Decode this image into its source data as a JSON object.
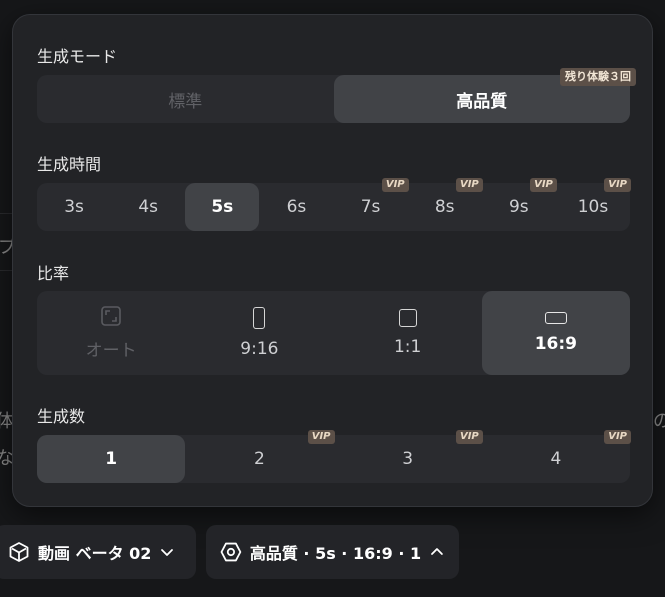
{
  "background": {
    "fragments": [
      "プ",
      "体",
      "な",
      "の"
    ]
  },
  "panel": {
    "mode": {
      "title": "生成モード",
      "options": [
        {
          "label": "標準",
          "selected": false,
          "disabled": true
        },
        {
          "label": "高品質",
          "selected": true,
          "badge": "残り体験３回"
        }
      ]
    },
    "duration": {
      "title": "生成時間",
      "vip_label": "VIP",
      "options": [
        {
          "label": "3s",
          "selected": false,
          "vip": false
        },
        {
          "label": "4s",
          "selected": false,
          "vip": false
        },
        {
          "label": "5s",
          "selected": true,
          "vip": false
        },
        {
          "label": "6s",
          "selected": false,
          "vip": false
        },
        {
          "label": "7s",
          "selected": false,
          "vip": true
        },
        {
          "label": "8s",
          "selected": false,
          "vip": true
        },
        {
          "label": "9s",
          "selected": false,
          "vip": true
        },
        {
          "label": "10s",
          "selected": false,
          "vip": true
        }
      ]
    },
    "ratio": {
      "title": "比率",
      "options": [
        {
          "label": "オート",
          "selected": false,
          "disabled": true,
          "icon": "auto-ratio-icon"
        },
        {
          "label": "9:16",
          "selected": false,
          "icon": "portrait-ratio-icon"
        },
        {
          "label": "1:1",
          "selected": false,
          "icon": "square-ratio-icon"
        },
        {
          "label": "16:9",
          "selected": true,
          "icon": "landscape-ratio-icon"
        }
      ]
    },
    "count": {
      "title": "生成数",
      "vip_label": "VIP",
      "options": [
        {
          "label": "1",
          "selected": true,
          "vip": false
        },
        {
          "label": "2",
          "selected": false,
          "vip": true
        },
        {
          "label": "3",
          "selected": false,
          "vip": true
        },
        {
          "label": "4",
          "selected": false,
          "vip": true
        }
      ]
    }
  },
  "bottom_bar": {
    "model_button": {
      "label": "動画 ベータ 02",
      "icon": "cube-icon",
      "chevron": "chevron-down-icon"
    },
    "settings_button": {
      "label": "高品質 · 5s · 16:9 · 1",
      "icon": "hexagon-settings-icon",
      "chevron": "chevron-up-icon"
    }
  }
}
